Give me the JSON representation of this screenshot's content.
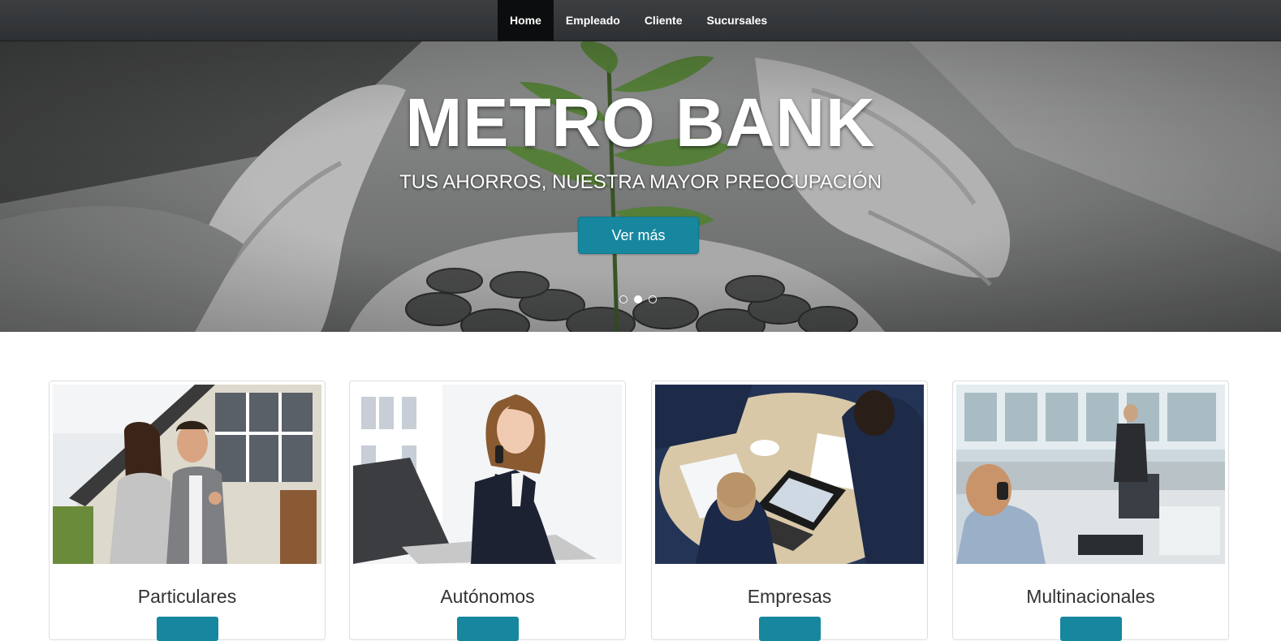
{
  "nav": {
    "items": [
      "Home",
      "Empleado",
      "Cliente",
      "Sucursales"
    ],
    "active": "Home"
  },
  "hero": {
    "title": "METRO BANK",
    "subtitle": "TUS AHORROS, NUESTRA MAYOR PREOCUPACIÓN",
    "button_label": "Ver más",
    "slides": 3,
    "active_slide": 2
  },
  "cards": [
    {
      "title": "Particulares"
    },
    {
      "title": "Autónomos"
    },
    {
      "title": "Empresas"
    },
    {
      "title": "Multinacionales"
    }
  ],
  "colors": {
    "navbar": "#35383a",
    "accent": "#17879f",
    "text": "#333333"
  }
}
